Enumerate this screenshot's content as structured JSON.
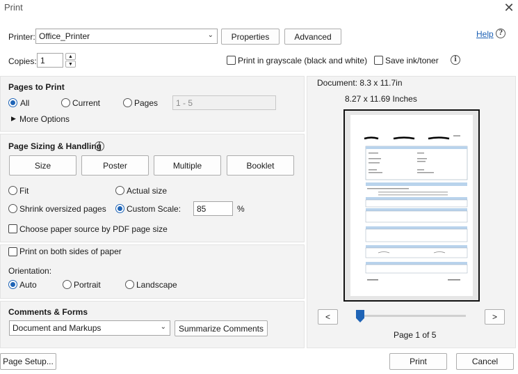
{
  "window": {
    "title": "Print"
  },
  "header": {
    "printer_label": "Printer:",
    "printer_value": "Office_Printer",
    "properties_label": "Properties",
    "advanced_label": "Advanced",
    "help_label": "Help",
    "copies_label": "Copies:",
    "copies_value": "1",
    "grayscale_label": "Print in grayscale (black and white)",
    "save_ink_label": "Save ink/toner"
  },
  "pages_to_print": {
    "title": "Pages to Print",
    "all_label": "All",
    "current_label": "Current",
    "pages_label": "Pages",
    "pages_placeholder": "1 - 5",
    "more_options_label": "More Options",
    "selected": "All"
  },
  "sizing": {
    "title": "Page Sizing & Handling",
    "tabs": [
      "Size",
      "Poster",
      "Multiple",
      "Booklet"
    ],
    "fit_label": "Fit",
    "actual_size_label": "Actual size",
    "shrink_label": "Shrink oversized pages",
    "custom_scale_label": "Custom Scale:",
    "custom_scale_value": "85",
    "percent_label": "%",
    "pdf_source_label": "Choose paper source by PDF page size",
    "selected": "Custom Scale"
  },
  "duplex": {
    "both_sides_label": "Print on both sides of paper",
    "orientation_label": "Orientation:",
    "auto_label": "Auto",
    "portrait_label": "Portrait",
    "landscape_label": "Landscape",
    "selected": "Auto"
  },
  "comments": {
    "title": "Comments & Forms",
    "select_value": "Document and Markups",
    "summarize_label": "Summarize Comments"
  },
  "preview": {
    "document_size": "Document: 8.3 x 11.7in",
    "page_size": "8.27 x 11.69 Inches",
    "prev_label": "<",
    "next_label": ">",
    "page_indicator": "Page 1 of 5"
  },
  "footer": {
    "page_setup_label": "Page Setup...",
    "print_label": "Print",
    "cancel_label": "Cancel"
  },
  "colors": {
    "accent": "#1f64b6",
    "panel_bg": "#f3f3f3"
  }
}
